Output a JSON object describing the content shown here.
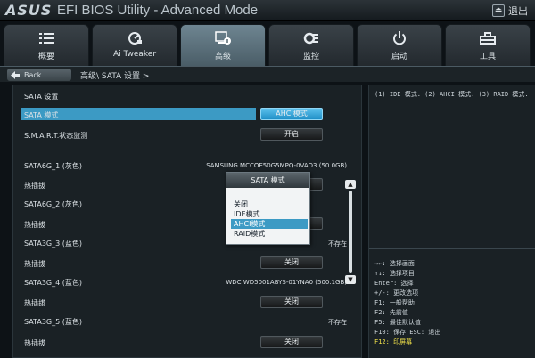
{
  "header": {
    "logo": "ASUS",
    "title": "EFI BIOS Utility - Advanced Mode",
    "exit_label": "退出"
  },
  "tabs": [
    {
      "label": "概要",
      "icon": "list-icon"
    },
    {
      "label": "Ai Tweaker",
      "icon": "tweaker-icon"
    },
    {
      "label": "高级",
      "icon": "advanced-icon",
      "active": true
    },
    {
      "label": "监控",
      "icon": "monitor-icon"
    },
    {
      "label": "启动",
      "icon": "power-icon"
    },
    {
      "label": "工具",
      "icon": "tool-icon"
    }
  ],
  "nav": {
    "back_label": "Back",
    "breadcrumb": "高级\\ SATA 设置 >"
  },
  "main": {
    "section_title": "SATA 设置",
    "sata_mode_label": "SATA 模式",
    "sata_mode_value": "AHCI模式",
    "smart_label": "S.M.A.R.T.状态监测",
    "smart_value": "开启",
    "ports": [
      {
        "label": "SATA6G_1 (灰色)",
        "device": "SAMSUNG MCCOE50G5MPQ-0VAD3 (50.0GB)",
        "hotplug_label": "热插拔",
        "hotplug_value": ""
      },
      {
        "label": "SATA6G_2 (灰色)",
        "device": "",
        "hotplug_label": "热插拔",
        "hotplug_value": ""
      },
      {
        "label": "SATA3G_3 (蓝色)",
        "device": "不存在",
        "hotplug_label": "热插拔",
        "hotplug_value": "关闭"
      },
      {
        "label": "SATA3G_4 (蓝色)",
        "device": "WDC WD5001ABYS-01YNA0 (500.1GB)",
        "hotplug_label": "热插拔",
        "hotplug_value": "关闭"
      },
      {
        "label": "SATA3G_5 (蓝色)",
        "device": "不存在",
        "hotplug_label": "热插拔",
        "hotplug_value": "关闭"
      }
    ]
  },
  "popup": {
    "title": "SATA 模式",
    "options": [
      "关闭",
      "IDE模式",
      "AHCI模式",
      "RAID模式"
    ],
    "selected_index": 2
  },
  "help": {
    "description": "(1) IDE 模式. (2) AHCI 模式. (3) RAID 模式.",
    "keys": [
      "→←: 选择画面",
      "↑↓: 选择项目",
      "Enter: 选择",
      "+/-: 更改选项",
      "F1: 一般帮助",
      "F2: 先前值",
      "F5: 最佳默认值",
      "F10: 保存  ESC: 退出",
      "F12: 印屏幕"
    ]
  },
  "colors": {
    "highlight": "#3c9ac4",
    "hotkey_accent": "#f3e34a",
    "active_tab": "#5f7681"
  }
}
